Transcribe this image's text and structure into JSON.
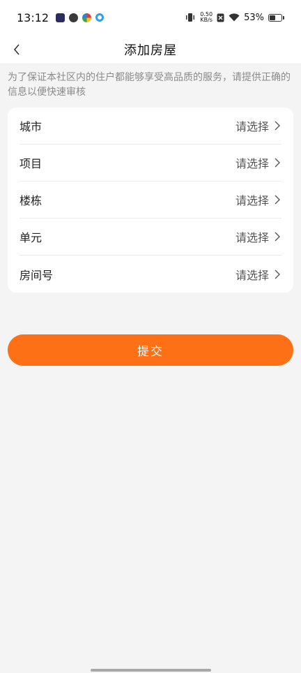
{
  "status_bar": {
    "time": "13:12",
    "network_speed_value": "0.50",
    "network_speed_unit": "KB/s",
    "battery_percent": "53%",
    "battery_level": 0.53
  },
  "nav": {
    "title": "添加房屋"
  },
  "notice": "为了保证本社区内的住户都能够享受高品质的服务，请提供正确的信息以便快速审核",
  "form": {
    "rows": [
      {
        "label": "城市",
        "value": "请选择"
      },
      {
        "label": "项目",
        "value": "请选择"
      },
      {
        "label": "楼栋",
        "value": "请选择"
      },
      {
        "label": "单元",
        "value": "请选择"
      },
      {
        "label": "房间号",
        "value": "请选择"
      }
    ]
  },
  "submit_label": "提交",
  "colors": {
    "accent": "#fd7016",
    "background": "#f4f4f4",
    "card": "#ffffff"
  }
}
